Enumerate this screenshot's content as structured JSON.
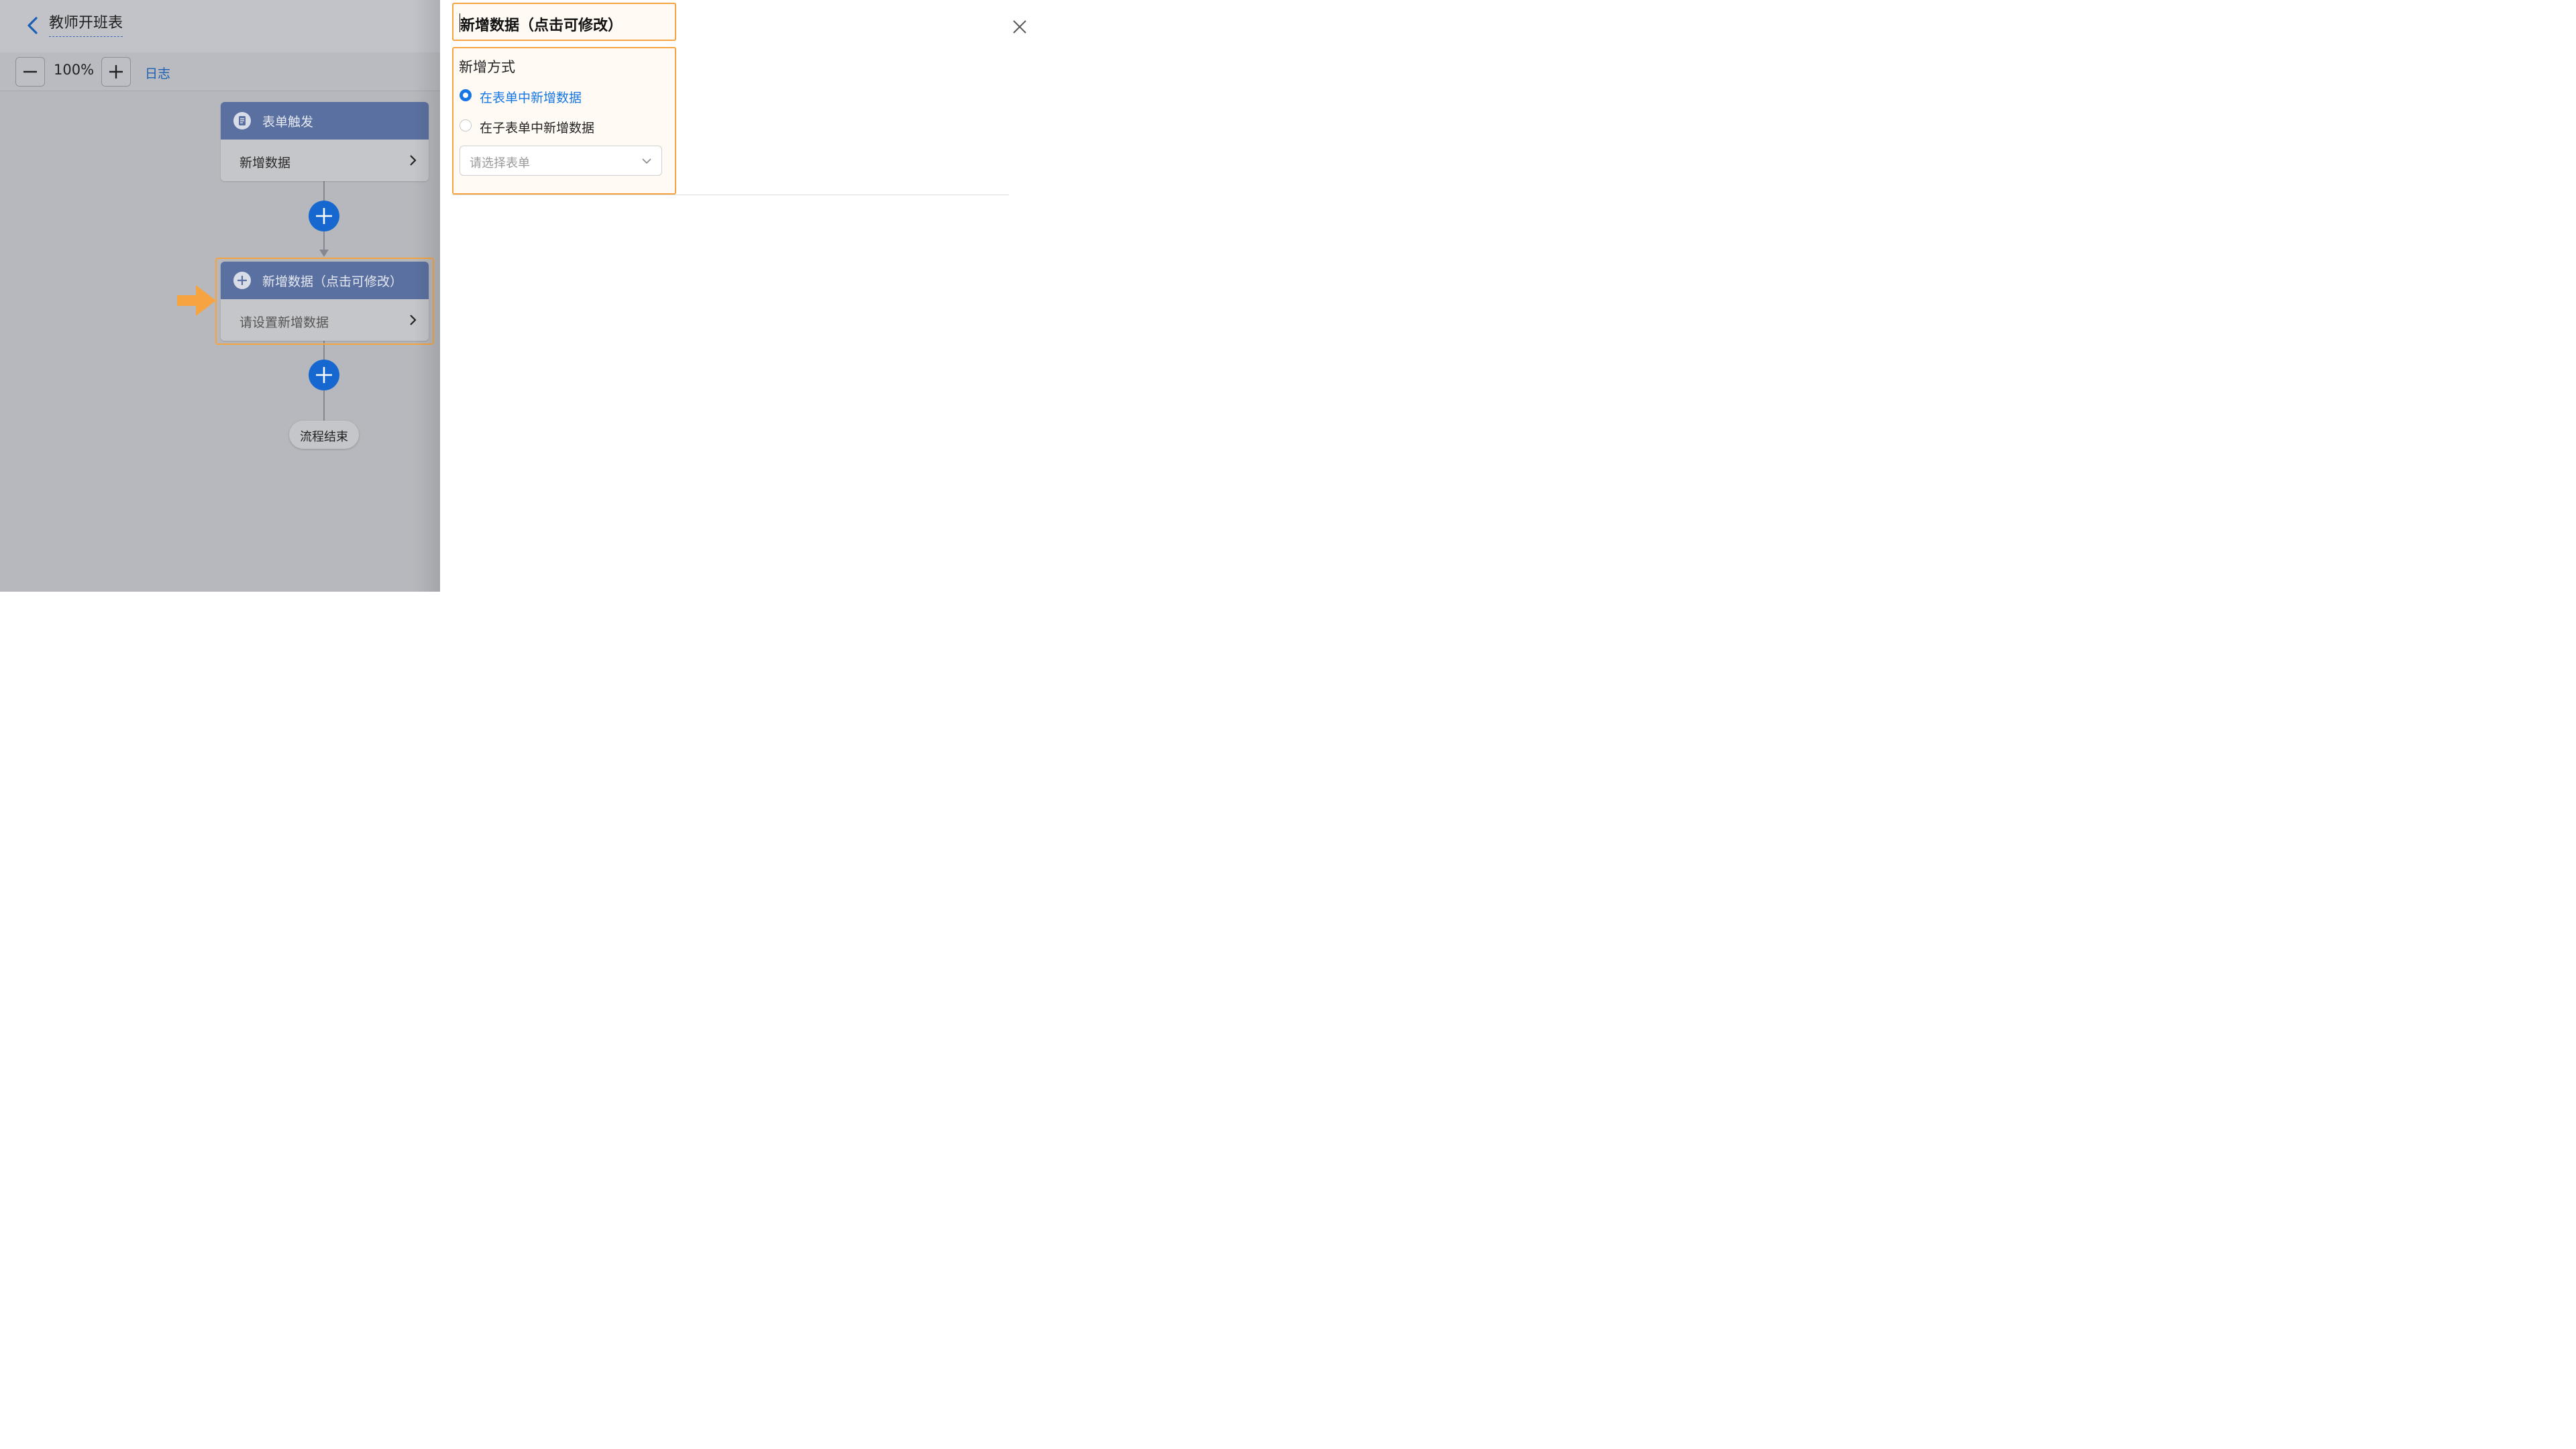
{
  "header": {
    "title": "教师开班表",
    "back_icon": "chevron-left-icon"
  },
  "toolbar": {
    "zoom_out_icon": "minus-icon",
    "zoom_level": "100%",
    "zoom_in_icon": "plus-icon",
    "log_label": "日志"
  },
  "flow": {
    "trigger_node": {
      "icon": "form-icon",
      "title": "表单触发",
      "body": "新增数据"
    },
    "action_node": {
      "icon": "plus-circle-icon",
      "title": "新增数据（点击可修改）",
      "body": "请设置新增数据"
    },
    "end_label": "流程结束"
  },
  "panel": {
    "node_name": "新增数据（点击可修改）",
    "section_label": "新增方式",
    "options": [
      {
        "label": "在表单中新增数据",
        "selected": true
      },
      {
        "label": "在子表单中新增数据",
        "selected": false
      }
    ],
    "select_placeholder": "请选择表单"
  },
  "colors": {
    "accent_blue": "#1677e4",
    "highlight_orange": "#f5a441",
    "node_header": "#5a70a0"
  }
}
